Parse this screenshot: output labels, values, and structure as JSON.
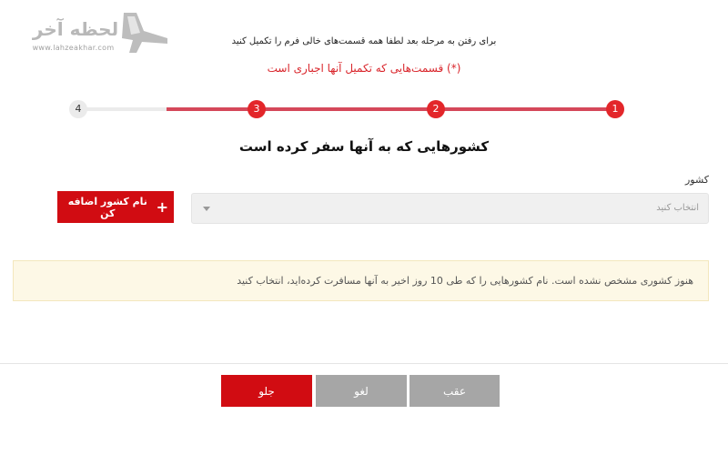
{
  "brand": {
    "name_fa": "لحظه آخر",
    "url": "www.lahzeakhar.com"
  },
  "intro": {
    "note": "برای رفتن به مرحله بعد لطفا همه قسمت‌های خالی فرم را تکمیل کنید",
    "required": "(*) قسمت‌هایی که تکمیل آنها اجباری است"
  },
  "stepper": {
    "steps": [
      "1",
      "2",
      "3",
      "4"
    ],
    "active_color": "#e3262a",
    "track_color": "#d5485a"
  },
  "section": {
    "title": "کشورهایی که به آنها سفر کرده است"
  },
  "country_field": {
    "label": "کشور",
    "placeholder": "انتخاب کنید"
  },
  "add_country": {
    "label": "نام کشور اضافه کن"
  },
  "alert": {
    "message": "هنوز کشوری مشخص نشده است. نام کشورهایی را که طی 10 روز اخیر به آنها مسافرت کرده‌اید، انتخاب کنید"
  },
  "footer": {
    "next": "جلو",
    "cancel": "لغو",
    "back": "عقب"
  }
}
